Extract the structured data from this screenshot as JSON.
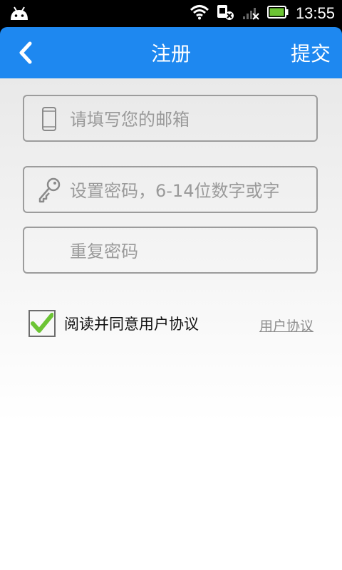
{
  "status_bar": {
    "time": "13:55",
    "icons": [
      "android-icon",
      "wifi-icon",
      "sim-card-icon",
      "signal-icon",
      "battery-icon"
    ]
  },
  "app_bar": {
    "back_icon": "chevron-left-icon",
    "title": "注册",
    "submit_label": "提交",
    "background": "#1e88f0"
  },
  "form": {
    "email": {
      "placeholder": "请填写您的邮箱",
      "value": "",
      "icon": "phone-icon"
    },
    "password": {
      "placeholder": "设置密码，6-14位数字或字",
      "value": "",
      "icon": "key-icon"
    },
    "confirm_password": {
      "placeholder": "重复密码",
      "value": ""
    }
  },
  "agreement": {
    "checked": true,
    "label": "阅读并同意用户协议",
    "link_label": "用户协议",
    "check_color": "#6cc434"
  }
}
